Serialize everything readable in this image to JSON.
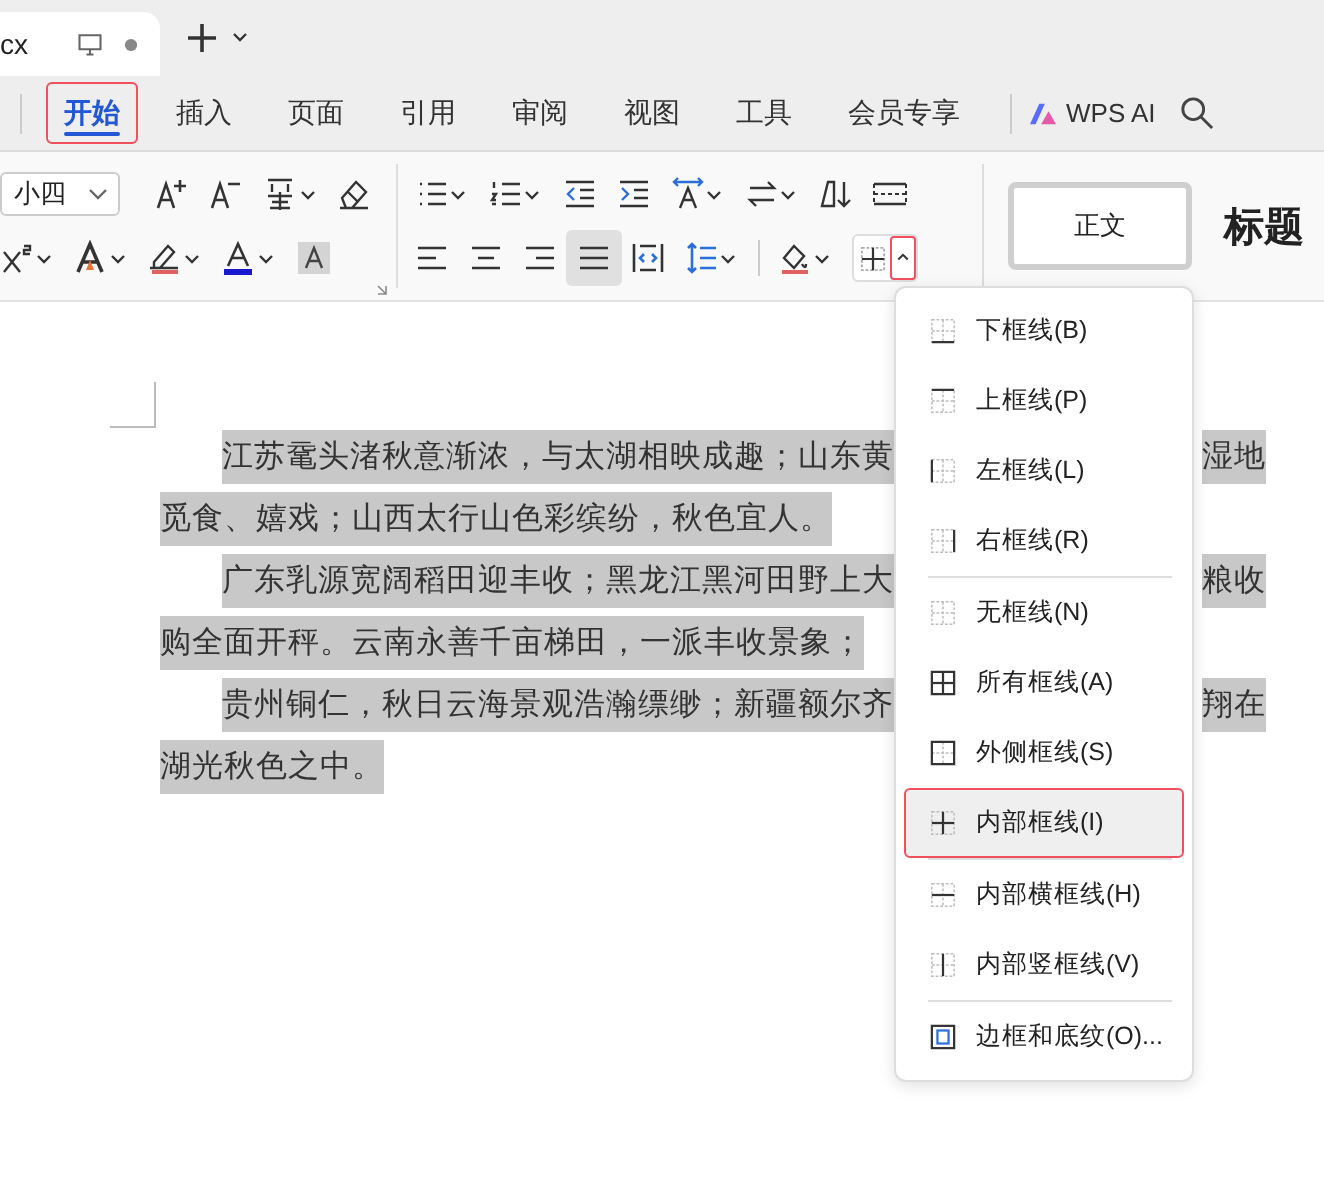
{
  "document_tab": {
    "title": "cx"
  },
  "ribbon_tabs": [
    {
      "label": "开始",
      "selected": true,
      "highlighted": true
    },
    {
      "label": "插入",
      "selected": false,
      "highlighted": false
    },
    {
      "label": "页面",
      "selected": false,
      "highlighted": false
    },
    {
      "label": "引用",
      "selected": false,
      "highlighted": false
    },
    {
      "label": "审阅",
      "selected": false,
      "highlighted": false
    },
    {
      "label": "视图",
      "selected": false,
      "highlighted": false
    },
    {
      "label": "工具",
      "selected": false,
      "highlighted": false
    },
    {
      "label": "会员专享",
      "selected": false,
      "highlighted": false
    }
  ],
  "wps_ai": "WPS AI",
  "toolbar": {
    "font_size": "小四",
    "borders_toggle": {
      "highlighted": true
    },
    "styles": [
      {
        "label": "正文",
        "kind": "body"
      },
      {
        "label": "标题",
        "kind": "heading"
      }
    ]
  },
  "document": {
    "lines": [
      {
        "text": "江苏鼋头渚秋意渐浓，与太湖相映成趣；山东黄",
        "right_text": "湿地",
        "indent": true
      },
      {
        "text": "觅食、嬉戏；山西太行山色彩缤纷，秋色宜人。",
        "indent": false
      },
      {
        "text": "广东乳源宽阔稻田迎丰收；黑龙江黑河田野上大",
        "right_text": "粮收",
        "indent": true
      },
      {
        "text": "购全面开秤。云南永善千亩梯田，一派丰收景象；",
        "indent": false
      },
      {
        "text": "贵州铜仁，秋日云海景观浩瀚缥缈；新疆额尔齐",
        "right_text": "翔在",
        "indent": true
      },
      {
        "text": "湖光秋色之中。",
        "indent": false
      }
    ]
  },
  "border_menu": {
    "groups": [
      [
        {
          "label": "下框线(B)",
          "kind": "bottom",
          "highlighted": false
        },
        {
          "label": "上框线(P)",
          "kind": "top",
          "highlighted": false
        },
        {
          "label": "左框线(L)",
          "kind": "left",
          "highlighted": false
        },
        {
          "label": "右框线(R)",
          "kind": "right",
          "highlighted": false
        }
      ],
      [
        {
          "label": "无框线(N)",
          "kind": "none",
          "highlighted": false
        },
        {
          "label": "所有框线(A)",
          "kind": "all",
          "highlighted": false
        },
        {
          "label": "外侧框线(S)",
          "kind": "outside",
          "highlighted": false
        },
        {
          "label": "内部框线(I)",
          "kind": "inside",
          "highlighted": true
        }
      ],
      [
        {
          "label": "内部横框线(H)",
          "kind": "inside-h",
          "highlighted": false
        },
        {
          "label": "内部竖框线(V)",
          "kind": "inside-v",
          "highlighted": false
        }
      ],
      [
        {
          "label": "边框和底纹(O)...",
          "kind": "dialog",
          "highlighted": false
        }
      ]
    ]
  }
}
